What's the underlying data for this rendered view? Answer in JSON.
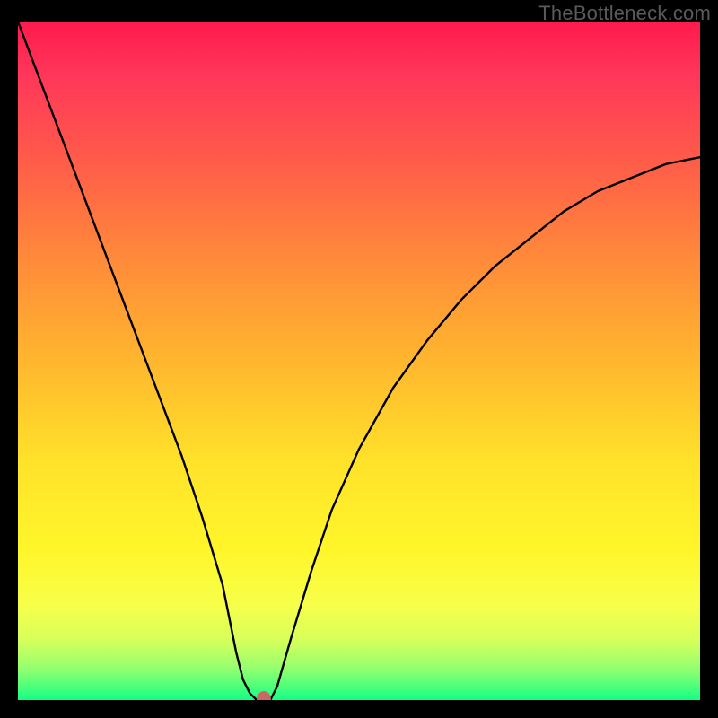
{
  "watermark": "TheBottleneck.com",
  "chart_data": {
    "type": "line",
    "title": "",
    "xlabel": "",
    "ylabel": "",
    "xlim": [
      0,
      100
    ],
    "ylim": [
      0,
      100
    ],
    "grid": false,
    "legend": false,
    "x": [
      0,
      3,
      6,
      9,
      12,
      15,
      18,
      21,
      24,
      27,
      30,
      32,
      33,
      34,
      35,
      36,
      37,
      38,
      40,
      43,
      46,
      50,
      55,
      60,
      65,
      70,
      75,
      80,
      85,
      90,
      95,
      100
    ],
    "values": [
      100,
      92,
      84,
      76,
      68,
      60,
      52,
      44,
      36,
      27,
      17,
      7,
      3,
      1,
      0,
      0,
      0,
      2,
      9,
      19,
      28,
      37,
      46,
      53,
      59,
      64,
      68,
      72,
      75,
      77,
      79,
      80
    ],
    "marker": {
      "x": 36,
      "y": 0
    },
    "background": "rainbow-vertical"
  }
}
